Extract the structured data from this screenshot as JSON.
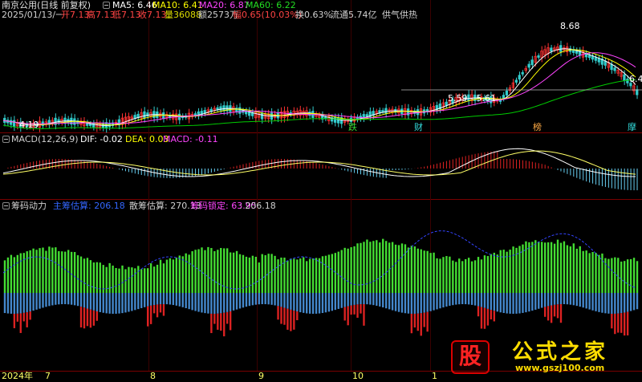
{
  "colors": {
    "background": "#000000",
    "separator": "#7a0000",
    "up": "#ff3333",
    "down": "#33cccc",
    "ma5": "#ffffff",
    "ma10": "#ffff00",
    "ma20": "#ff44ff",
    "ma60": "#00cc00",
    "green_bar": "#44dd33",
    "blue_bar": "#4488cc",
    "red_bar": "#dd2222",
    "dashed_line": "#3344ff",
    "watermark": "#ffdd00"
  },
  "main_panel": {
    "stock_title": "南京公用(日线 前复权)",
    "ma5": "MA5: 6.46",
    "ma10": "MA10: 6.41",
    "ma20": "MA20: 6.87",
    "ma60": "MA60: 6.22",
    "date": "2025/01/13/一",
    "open": "开7.13",
    "high": "高7.13",
    "low": "低7.13",
    "close": "收7.13",
    "volume": "量36088",
    "amount": "额2573万",
    "change": "幅0.65(10.03%)",
    "turnover": "换0.63%",
    "float_cap": "流通5.74亿",
    "concept": "供气供热",
    "peak_label": "8.68",
    "low_label": "4.19",
    "range_label": "5.59 - 5.61",
    "right_edge_label": "6.4",
    "event_markers": [
      "跌",
      "财",
      "榜",
      "摩"
    ]
  },
  "macd_panel": {
    "name": "MACD(12,26,9)",
    "dif": "DIF: -0.02",
    "dea": "DEA: 0.03",
    "macd": "MACD: -0.11"
  },
  "chip_panel": {
    "name": "筹码动力",
    "main_estimate": "主筹估算: 206.18",
    "retail_estimate": "散筹估算: 270.13",
    "lock": "筹码锁定: 63.95",
    "extra": ": 206.18"
  },
  "time_axis": {
    "labels": [
      "2024年",
      "7",
      "8",
      "9",
      "10",
      "1"
    ]
  },
  "watermark": {
    "stamp": "股",
    "brand": "公式之家",
    "url": "www.gszj100.com"
  }
}
